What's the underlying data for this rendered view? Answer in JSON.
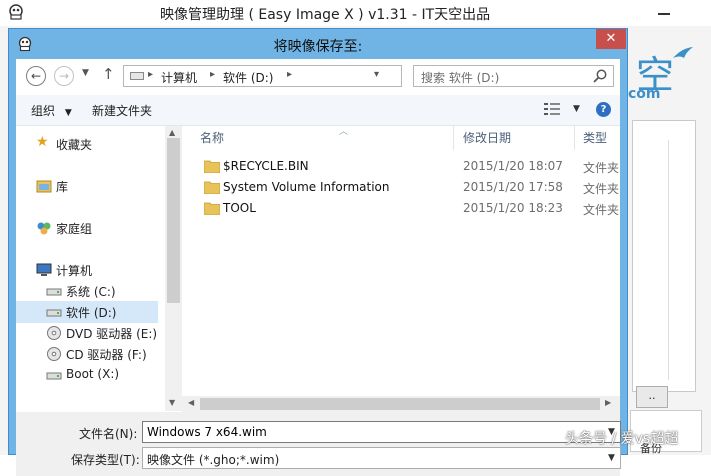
{
  "main_window": {
    "title": "映像管理助理 ( Easy Image X ) v1.31 - IT天空出品",
    "logo_char": "空",
    "logo_com": "com",
    "browse_label": "..",
    "bottom_right_text": "备份"
  },
  "watermark": "头条号 / 爱vs超超",
  "dialog": {
    "title": "将映像保存至:",
    "close_label": "✕",
    "breadcrumb": [
      "计算机",
      "软件 (D:)"
    ],
    "search_placeholder": "搜索 软件 (D:)",
    "toolbar": {
      "organize_label": "组织",
      "new_folder_label": "新建文件夹"
    },
    "nav_items": [
      {
        "label": "收藏夹",
        "icon": "star-icon"
      },
      {
        "label": "库",
        "icon": "library-icon"
      },
      {
        "label": "家庭组",
        "icon": "homegroup-icon"
      },
      {
        "label": "计算机",
        "icon": "computer-icon"
      },
      {
        "label": "系统 (C:)",
        "icon": "drive-icon"
      },
      {
        "label": "软件 (D:)",
        "icon": "drive-icon",
        "selected": true
      },
      {
        "label": "DVD 驱动器 (E:)",
        "icon": "dvd-icon"
      },
      {
        "label": "CD 驱动器 (F:)",
        "icon": "cd-icon"
      },
      {
        "label": "Boot (X:)",
        "icon": "drive-icon"
      }
    ],
    "columns": {
      "name": "名称",
      "date": "修改日期",
      "type": "类型"
    },
    "files": [
      {
        "name": "$RECYCLE.BIN",
        "date": "2015/1/20 18:07",
        "type": "文件夹"
      },
      {
        "name": "System Volume Information",
        "date": "2015/1/20 17:58",
        "type": "文件夹"
      },
      {
        "name": "TOOL",
        "date": "2015/1/20 18:23",
        "type": "文件夹"
      }
    ],
    "filename_label": "文件名(N):",
    "filename_value": "Windows 7 x64.wim",
    "filetype_label": "保存类型(T):",
    "filetype_value": "映像文件 (*.gho;*.wim)"
  },
  "colors": {
    "dialog_frame": "#6fb4e4",
    "close_red": "#c7504c",
    "selection": "#d5e8f9",
    "folder": "#e8c35a"
  }
}
